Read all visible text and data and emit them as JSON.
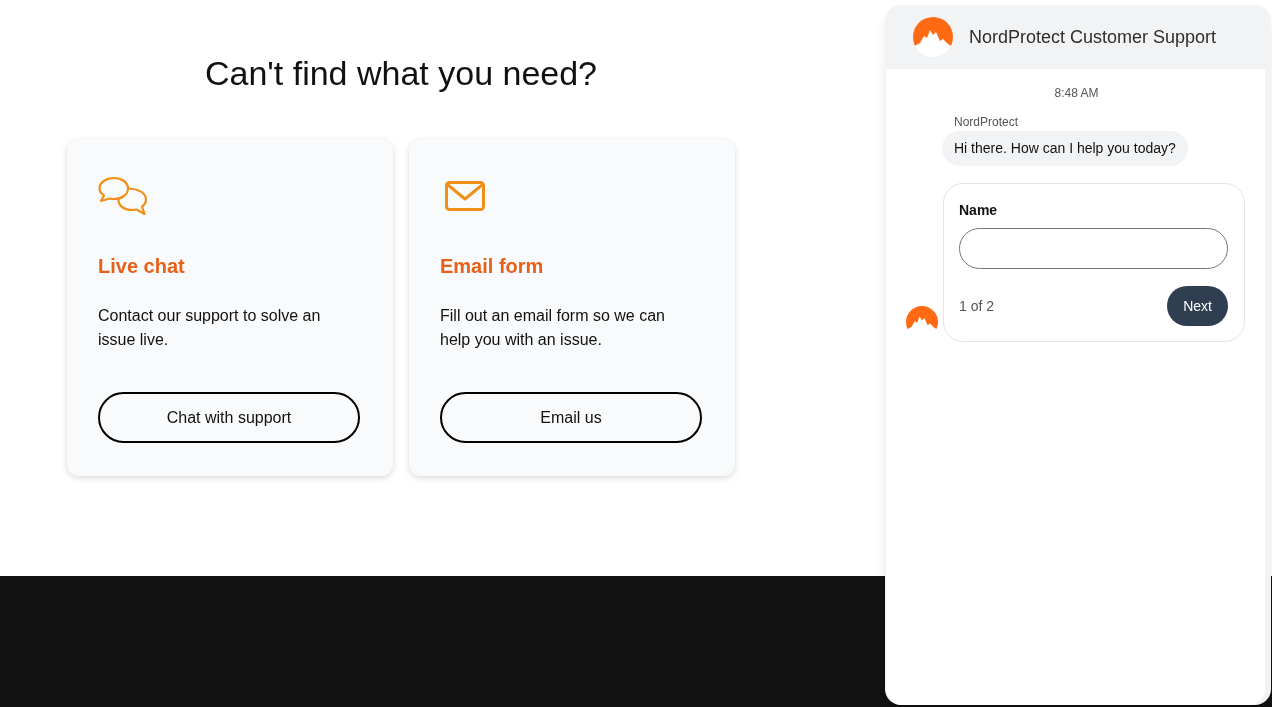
{
  "heading": "Can't find what you need?",
  "cards": [
    {
      "kind": "chat",
      "title": "Live chat",
      "description": "Contact our support to solve an issue live.",
      "button": "Chat with support"
    },
    {
      "kind": "email",
      "title": "Email form",
      "description": "Fill out an email form so we can help you with an issue.",
      "button": "Email us"
    }
  ],
  "chat_widget": {
    "title": "NordProtect Customer Support",
    "timestamp": "8:48 AM",
    "messages": [
      {
        "sender": "NordProtect",
        "text": "Hi there. How can I help you today?"
      }
    ],
    "form": {
      "field_label": "Name",
      "step": "1 of 2",
      "button": "Next"
    }
  }
}
